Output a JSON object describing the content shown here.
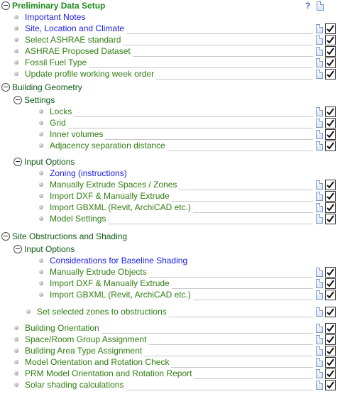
{
  "header": {
    "title": "Preliminary Data Setup",
    "help_glyph": "?"
  },
  "rows": [
    {
      "id": "important-notes",
      "label": "Important Notes"
    },
    {
      "id": "site-location-climate",
      "label": "Site, Location and Climate"
    },
    {
      "id": "select-ashrae-standard",
      "label": "Select ASHRAE standard"
    },
    {
      "id": "ashrae-proposed-dataset",
      "label": "ASHRAE Proposed Dataset"
    },
    {
      "id": "fossil-fuel-type",
      "label": "Fossil Fuel Type"
    },
    {
      "id": "update-profile-working-week-order",
      "label": "Update profile working week order"
    },
    {
      "id": "building-geometry",
      "label": "Building Geometry"
    },
    {
      "id": "settings",
      "label": "Settings"
    },
    {
      "id": "locks",
      "label": "Locks"
    },
    {
      "id": "grid",
      "label": "Grid"
    },
    {
      "id": "inner-volumes",
      "label": "Inner volumes"
    },
    {
      "id": "adjacency-separation-distance",
      "label": "Adjacency separation distance"
    },
    {
      "id": "input-options-geometry",
      "label": "Input Options"
    },
    {
      "id": "zoning-instructions",
      "label": "Zoning (instructions)"
    },
    {
      "id": "manually-extrude-spaces-zones",
      "label": "Manually Extrude Spaces / Zones"
    },
    {
      "id": "import-dxf-extrude-geometry",
      "label": "Import DXF & Manually Extrude"
    },
    {
      "id": "import-gbxml-geometry",
      "label": "Import GBXML (Revit, ArchiCAD etc.)"
    },
    {
      "id": "model-settings",
      "label": "Model Settings"
    },
    {
      "id": "site-obstructions-shading",
      "label": "Site Obstructions and Shading"
    },
    {
      "id": "input-options-shading",
      "label": "Input Options"
    },
    {
      "id": "considerations-baseline-shading",
      "label": "Considerations for Baseline Shading"
    },
    {
      "id": "manually-extrude-objects",
      "label": "Manually Extrude Objects"
    },
    {
      "id": "import-dxf-extrude-shading",
      "label": "Import DXF & Manually Extrude"
    },
    {
      "id": "import-gbxml-shading",
      "label": "Import GBXML (Revit, ArchiCAD etc.)"
    },
    {
      "id": "set-selected-zones-obstructions",
      "label": "Set selected zones to obstructions"
    },
    {
      "id": "building-orientation",
      "label": "Building Orientation"
    },
    {
      "id": "space-room-group-assignment",
      "label": "Space/Room Group Assignment"
    },
    {
      "id": "building-area-type-assignment",
      "label": "Building Area Type Assignment"
    },
    {
      "id": "model-orientation-rotation-check",
      "label": "Model Orientation and Rotation Check"
    },
    {
      "id": "prm-model-orientation-rotation-report",
      "label": "PRM Model Orientation and Rotation Report"
    },
    {
      "id": "solar-shading-calculations",
      "label": "Solar shading calculations"
    }
  ]
}
